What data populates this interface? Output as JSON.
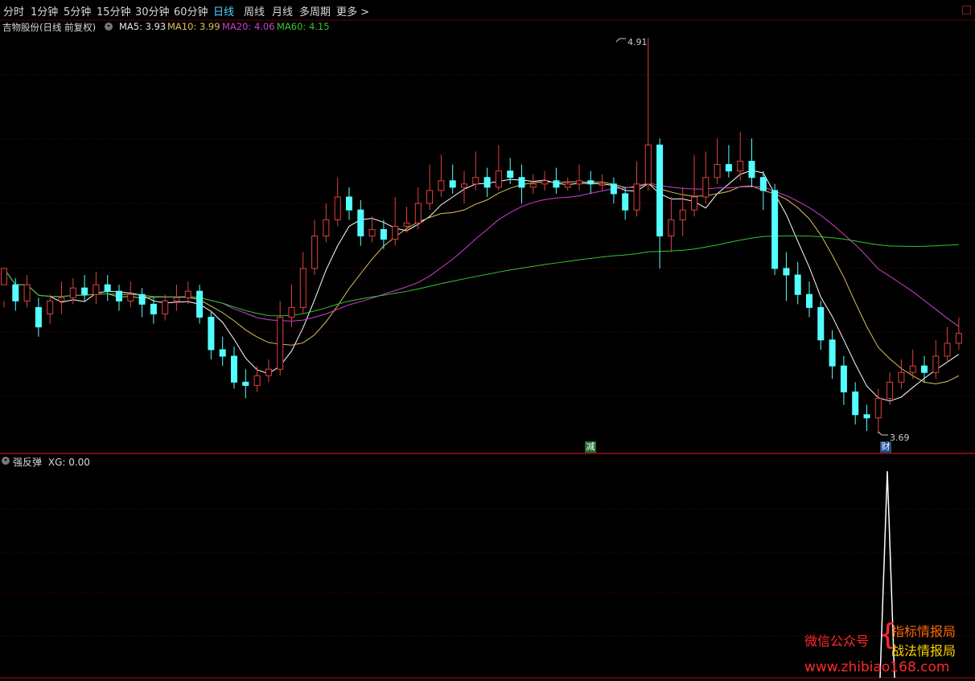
{
  "toolbar": {
    "tabs": [
      "分时",
      "1分钟",
      "5分钟",
      "15分钟",
      "30分钟",
      "60分钟",
      "日线",
      "周线",
      "月线",
      "多周期",
      "更多 >"
    ],
    "active_index": 6
  },
  "legend": {
    "title": "吉物股份(日线 前复权)",
    "ma5": "MA5: 3.93",
    "ma10": "MA10: 3.99",
    "ma20": "MA20: 4.06",
    "ma60": "MA60: 4.15"
  },
  "colors": {
    "up": "#e04040",
    "down": "#54ffff",
    "ma5": "#ffffff",
    "ma10": "#d9c15a",
    "ma20": "#d03ed0",
    "ma60": "#33c433",
    "grid": "#7a0000",
    "tab_active": "#4fd2ff"
  },
  "price_labels": {
    "high": "4.91",
    "low": "3.69"
  },
  "event_badges": {
    "reduce": "减",
    "finance": "财"
  },
  "indicator": {
    "name": "强反弹",
    "value_label": "XG: 0.00"
  },
  "watermark": {
    "line1": "微信公众号",
    "line2": "指标情报局",
    "line3": "战法情报局",
    "url": "www.zhibiao168.com"
  },
  "chart_data": {
    "type": "candlestick",
    "y_range": [
      3.69,
      4.91
    ],
    "candles": [
      [
        4.15,
        4.2,
        4.1,
        4.08
      ],
      [
        4.15,
        4.1,
        4.17,
        4.07
      ],
      [
        4.1,
        4.15,
        4.18,
        4.08
      ],
      [
        4.08,
        4.02,
        4.11,
        3.99
      ],
      [
        4.06,
        4.1,
        4.12,
        4.03
      ],
      [
        4.1,
        4.11,
        4.16,
        4.06
      ],
      [
        4.11,
        4.14,
        4.17,
        4.09
      ],
      [
        4.14,
        4.12,
        4.18,
        4.1
      ],
      [
        4.12,
        4.15,
        4.19,
        4.09
      ],
      [
        4.15,
        4.13,
        4.18,
        4.1
      ],
      [
        4.13,
        4.1,
        4.15,
        4.07
      ],
      [
        4.1,
        4.12,
        4.16,
        4.08
      ],
      [
        4.12,
        4.09,
        4.14,
        4.05
      ],
      [
        4.09,
        4.06,
        4.11,
        4.03
      ],
      [
        4.06,
        4.1,
        4.12,
        4.04
      ],
      [
        4.1,
        4.11,
        4.15,
        4.07
      ],
      [
        4.11,
        4.13,
        4.16,
        4.09
      ],
      [
        4.13,
        4.05,
        4.15,
        4.03
      ],
      [
        4.05,
        3.95,
        4.07,
        3.92
      ],
      [
        3.95,
        3.93,
        3.99,
        3.9
      ],
      [
        3.93,
        3.85,
        3.96,
        3.83
      ],
      [
        3.85,
        3.84,
        3.89,
        3.8
      ],
      [
        3.84,
        3.87,
        3.9,
        3.82
      ],
      [
        3.87,
        3.89,
        3.92,
        3.85
      ],
      [
        3.89,
        4.05,
        4.1,
        3.87
      ],
      [
        4.05,
        4.08,
        4.15,
        4.02
      ],
      [
        4.08,
        4.2,
        4.25,
        4.06
      ],
      [
        4.2,
        4.3,
        4.35,
        4.18
      ],
      [
        4.3,
        4.35,
        4.4,
        4.28
      ],
      [
        4.35,
        4.42,
        4.48,
        4.33
      ],
      [
        4.42,
        4.38,
        4.45,
        4.35
      ],
      [
        4.38,
        4.3,
        4.41,
        4.27
      ],
      [
        4.3,
        4.32,
        4.36,
        4.28
      ],
      [
        4.32,
        4.29,
        4.35,
        4.26
      ],
      [
        4.29,
        4.33,
        4.42,
        4.27
      ],
      [
        4.33,
        4.34,
        4.39,
        4.31
      ],
      [
        4.34,
        4.4,
        4.45,
        4.32
      ],
      [
        4.4,
        4.44,
        4.52,
        4.38
      ],
      [
        4.44,
        4.47,
        4.55,
        4.42
      ],
      [
        4.47,
        4.45,
        4.52,
        4.43
      ],
      [
        4.45,
        4.46,
        4.5,
        4.4
      ],
      [
        4.46,
        4.48,
        4.56,
        4.44
      ],
      [
        4.48,
        4.45,
        4.51,
        4.42
      ],
      [
        4.45,
        4.5,
        4.58,
        4.44
      ],
      [
        4.5,
        4.48,
        4.54,
        4.46
      ],
      [
        4.48,
        4.45,
        4.52,
        4.4
      ],
      [
        4.45,
        4.46,
        4.49,
        4.43
      ],
      [
        4.46,
        4.47,
        4.5,
        4.44
      ],
      [
        4.47,
        4.45,
        4.51,
        4.43
      ],
      [
        4.45,
        4.46,
        4.48,
        4.44
      ],
      [
        4.46,
        4.47,
        4.52,
        4.44
      ],
      [
        4.47,
        4.46,
        4.5,
        4.43
      ],
      [
        4.46,
        4.46,
        4.49,
        4.44
      ],
      [
        4.46,
        4.43,
        4.48,
        4.4
      ],
      [
        4.43,
        4.38,
        4.45,
        4.35
      ],
      [
        4.38,
        4.46,
        4.53,
        4.36
      ],
      [
        4.46,
        4.58,
        4.91,
        4.44
      ],
      [
        4.58,
        4.3,
        4.6,
        4.2
      ],
      [
        4.3,
        4.35,
        4.42,
        4.25
      ],
      [
        4.35,
        4.38,
        4.45,
        4.3
      ],
      [
        4.38,
        4.42,
        4.55,
        4.36
      ],
      [
        4.42,
        4.48,
        4.56,
        4.4
      ],
      [
        4.48,
        4.52,
        4.6,
        4.46
      ],
      [
        4.52,
        4.5,
        4.58,
        4.48
      ],
      [
        4.5,
        4.53,
        4.62,
        4.47
      ],
      [
        4.53,
        4.48,
        4.6,
        4.45
      ],
      [
        4.48,
        4.44,
        4.5,
        4.38
      ],
      [
        4.44,
        4.2,
        4.46,
        4.18
      ],
      [
        4.2,
        4.18,
        4.25,
        4.1
      ],
      [
        4.18,
        4.12,
        4.22,
        4.09
      ],
      [
        4.12,
        4.08,
        4.16,
        4.05
      ],
      [
        4.08,
        3.98,
        4.1,
        3.95
      ],
      [
        3.98,
        3.9,
        4.01,
        3.86
      ],
      [
        3.9,
        3.82,
        3.93,
        3.78
      ],
      [
        3.82,
        3.75,
        3.85,
        3.72
      ],
      [
        3.75,
        3.74,
        3.78,
        3.7
      ],
      [
        3.74,
        3.8,
        3.83,
        3.69
      ],
      [
        3.8,
        3.85,
        3.88,
        3.78
      ],
      [
        3.85,
        3.88,
        3.92,
        3.83
      ],
      [
        3.88,
        3.9,
        3.95,
        3.86
      ],
      [
        3.9,
        3.88,
        3.93,
        3.85
      ],
      [
        3.88,
        3.93,
        3.98,
        3.86
      ],
      [
        3.93,
        3.97,
        4.02,
        3.91
      ],
      [
        3.97,
        4.0,
        4.05,
        3.95
      ]
    ]
  }
}
